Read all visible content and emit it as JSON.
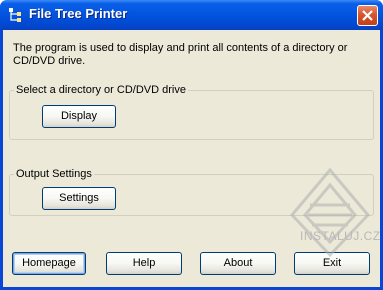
{
  "window": {
    "title": "File Tree Printer"
  },
  "description": "The program is used to display and print all contents of a directory or CD/DVD drive.",
  "directory_group": {
    "legend": "Select a directory or CD/DVD drive",
    "display_label": "Display"
  },
  "output_group": {
    "legend": "Output Settings",
    "settings_label": "Settings"
  },
  "buttons": {
    "homepage": "Homepage",
    "help": "Help",
    "about": "About",
    "exit": "Exit"
  },
  "watermark": {
    "text": "INSTALUJ.CZ"
  },
  "colors": {
    "titlebar": "#0355e0",
    "close": "#d7562e",
    "client": "#ece9d8",
    "button_border": "#003c74"
  }
}
